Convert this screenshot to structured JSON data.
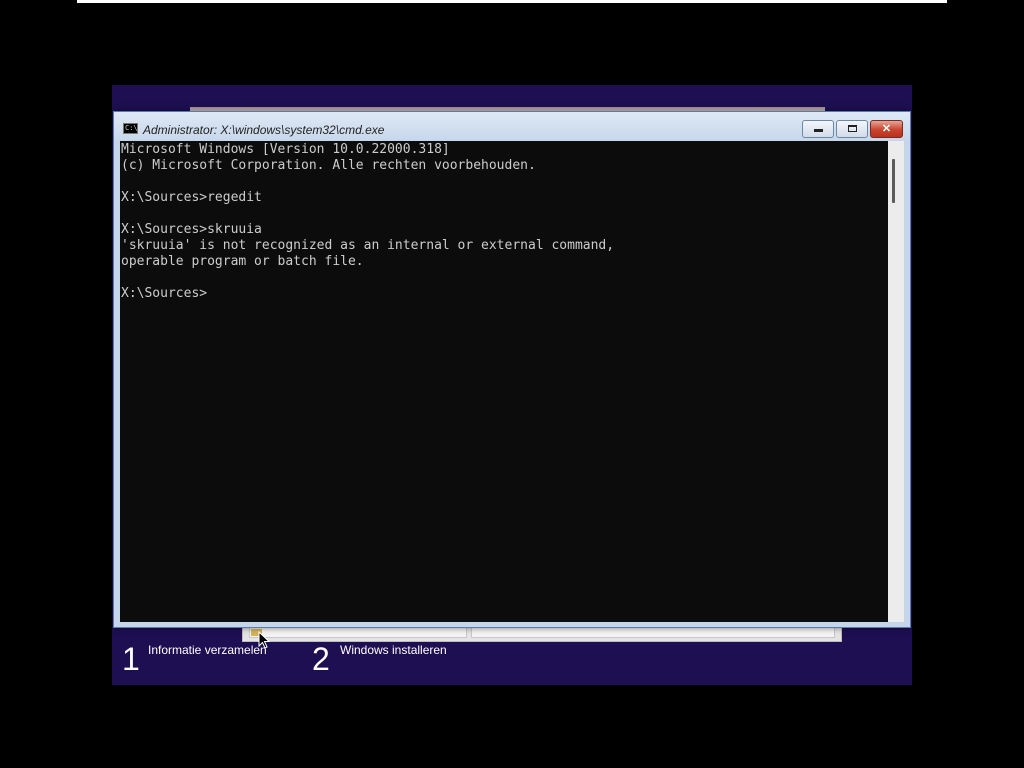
{
  "window": {
    "title": "Administrator: X:\\windows\\system32\\cmd.exe",
    "icon": "cmd-icon",
    "buttons": {
      "minimize": "minimize-icon",
      "maximize": "maximize-icon",
      "close": "✕"
    }
  },
  "console": {
    "lines": [
      "Microsoft Windows [Version 10.0.22000.318]",
      "(c) Microsoft Corporation. Alle rechten voorbehouden.",
      "",
      "X:\\Sources>regedit",
      "",
      "X:\\Sources>skruuia",
      "'skruuia' is not recognized as an internal or external command,",
      "operable program or batch file.",
      "",
      "X:\\Sources>"
    ]
  },
  "setup": {
    "steps": [
      {
        "number": "1",
        "label": "Informatie verzamelen"
      },
      {
        "number": "2",
        "label": "Windows installeren"
      }
    ],
    "progress": 0.05
  },
  "colors": {
    "setup_background": "#1e0f52",
    "console_background": "#0c0c0c",
    "console_text": "#cccccc",
    "close_button": "#c9442f"
  }
}
